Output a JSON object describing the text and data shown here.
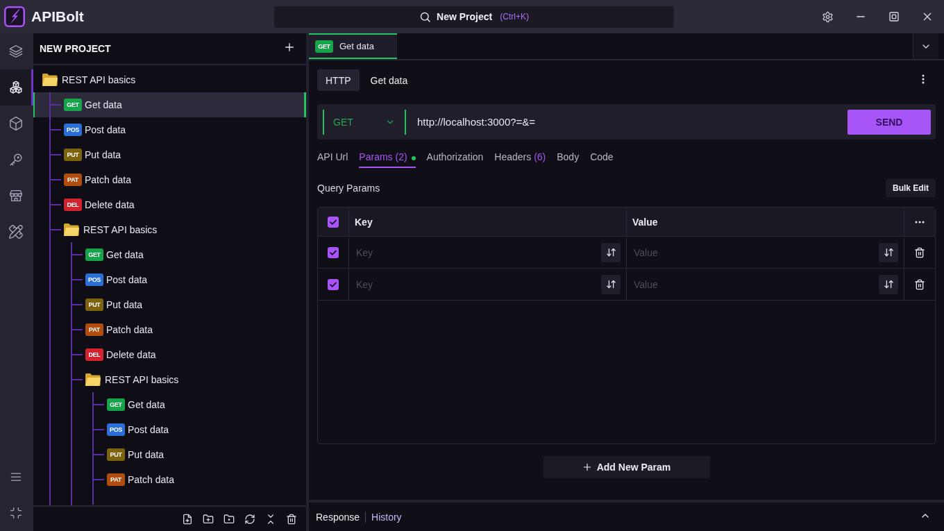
{
  "app": {
    "name": "APIBolt"
  },
  "search": {
    "label": "New Project",
    "shortcut": "(Ctrl+K)"
  },
  "activity_bar": {
    "items": [
      {
        "kind": "layers",
        "selected": false
      },
      {
        "kind": "cubes",
        "selected": true
      },
      {
        "kind": "box",
        "selected": false
      },
      {
        "kind": "key",
        "selected": false
      },
      {
        "kind": "store",
        "selected": false
      },
      {
        "kind": "tools",
        "selected": false
      }
    ]
  },
  "sidebar": {
    "title": "NEW PROJECT",
    "tree": [
      {
        "kind": "folder",
        "label": "REST API basics",
        "selected": false,
        "children": [
          {
            "kind": "request",
            "method": "GET",
            "color": "#17a34a",
            "label": "Get data",
            "selected": true
          },
          {
            "kind": "request",
            "method": "POS",
            "color": "#2b6fd6",
            "label": "Post data",
            "selected": false
          },
          {
            "kind": "request",
            "method": "PUT",
            "color": "#7d6310",
            "label": "Put data",
            "selected": false
          },
          {
            "kind": "request",
            "method": "PAT",
            "color": "#b24d10",
            "label": "Patch data",
            "selected": false
          },
          {
            "kind": "request",
            "method": "DEL",
            "color": "#d2232f",
            "label": "Delete data",
            "selected": false
          },
          {
            "kind": "folder",
            "label": "REST API basics",
            "selected": false,
            "children": [
              {
                "kind": "request",
                "method": "GET",
                "color": "#17a34a",
                "label": "Get data",
                "selected": false
              },
              {
                "kind": "request",
                "method": "POS",
                "color": "#2b6fd6",
                "label": "Post data",
                "selected": false
              },
              {
                "kind": "request",
                "method": "PUT",
                "color": "#7d6310",
                "label": "Put data",
                "selected": false
              },
              {
                "kind": "request",
                "method": "PAT",
                "color": "#b24d10",
                "label": "Patch data",
                "selected": false
              },
              {
                "kind": "request",
                "method": "DEL",
                "color": "#d2232f",
                "label": "Delete data",
                "selected": false
              },
              {
                "kind": "folder",
                "label": "REST API basics",
                "selected": false,
                "children": [
                  {
                    "kind": "request",
                    "method": "GET",
                    "color": "#17a34a",
                    "label": "Get data",
                    "selected": false
                  },
                  {
                    "kind": "request",
                    "method": "POS",
                    "color": "#2b6fd6",
                    "label": "Post data",
                    "selected": false
                  },
                  {
                    "kind": "request",
                    "method": "PUT",
                    "color": "#7d6310",
                    "label": "Put data",
                    "selected": false
                  },
                  {
                    "kind": "request",
                    "method": "PAT",
                    "color": "#b24d10",
                    "label": "Patch data",
                    "selected": false
                  }
                ]
              }
            ]
          }
        ]
      }
    ]
  },
  "tabs": [
    {
      "method": "GET",
      "color": "#17a34a",
      "label": "Get data",
      "selected": true
    }
  ],
  "request": {
    "protocol": "HTTP",
    "name": "Get data",
    "method": "GET",
    "url": "http://localhost:3000?=&=",
    "send": "SEND"
  },
  "subtabs": [
    {
      "label": "API Url",
      "selected": false,
      "changed": false
    },
    {
      "label": "Params",
      "count": "(2)",
      "selected": true,
      "changed": true
    },
    {
      "label": "Authorization",
      "selected": false,
      "changed": false
    },
    {
      "label": "Headers",
      "count": "(6)",
      "selected": false,
      "changed": false
    },
    {
      "label": "Body",
      "selected": false,
      "changed": false
    },
    {
      "label": "Code",
      "selected": false,
      "changed": false
    }
  ],
  "query_params": {
    "title": "Query Params",
    "bulk_edit": "Bulk Edit",
    "all_checked": true,
    "columns": [
      "Key",
      "Value"
    ],
    "rows": [
      {
        "checked": true,
        "key_placeholder": "Key",
        "value_placeholder": "Value"
      },
      {
        "checked": true,
        "key_placeholder": "Key",
        "value_placeholder": "Value"
      }
    ],
    "add_button": "Add New Param"
  },
  "bottom_panel": {
    "tabs": [
      {
        "label": "Response",
        "selected": true
      },
      {
        "label": "History",
        "selected": false
      }
    ]
  }
}
